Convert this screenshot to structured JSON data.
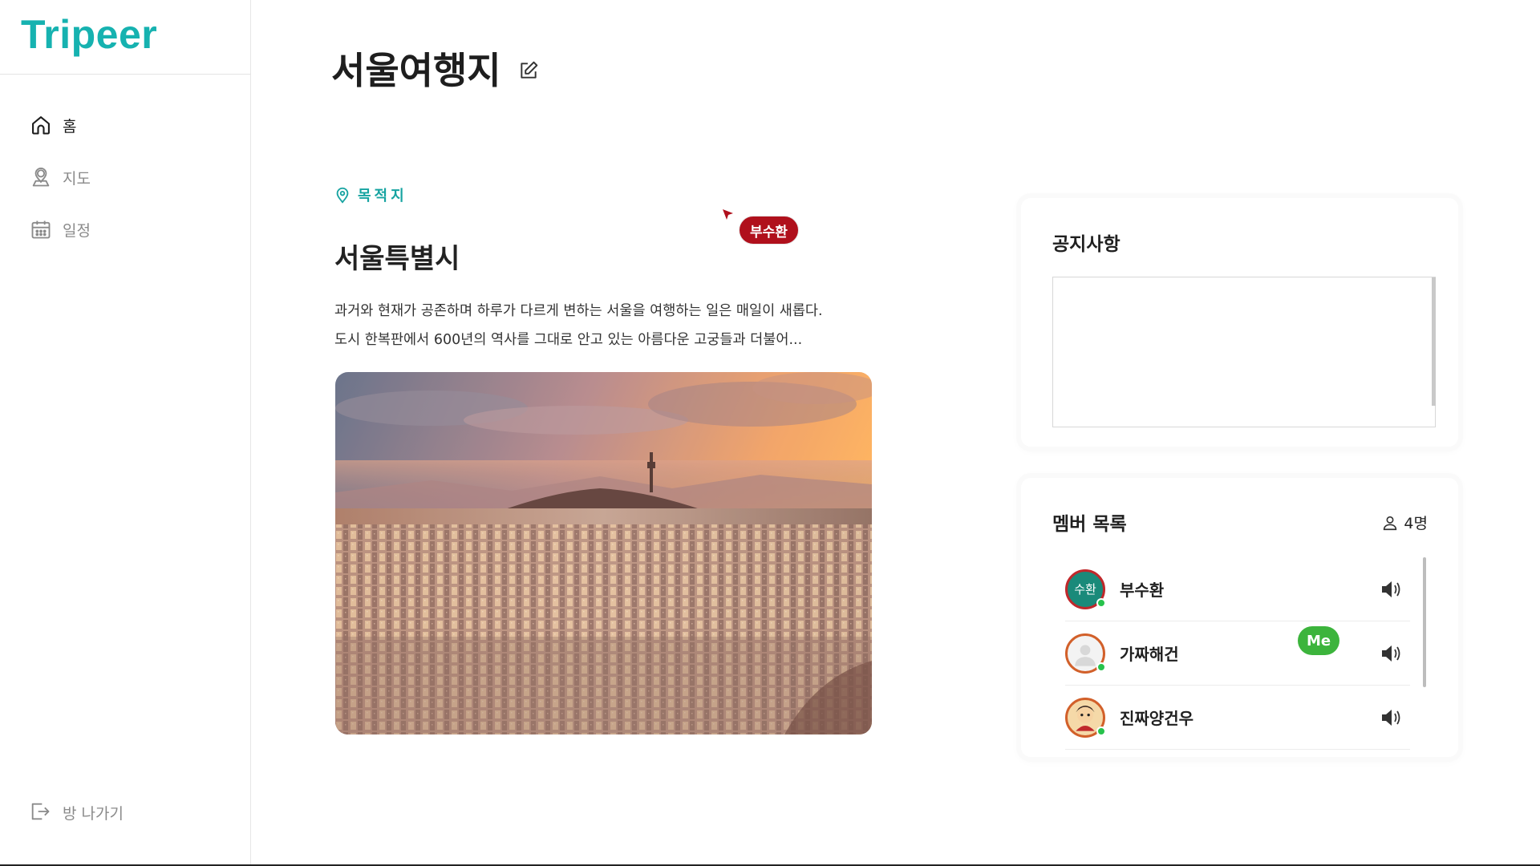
{
  "app": {
    "logo": "Tripeer",
    "brand_color": "#16b2b0"
  },
  "sidebar": {
    "items": [
      {
        "label": "홈",
        "icon": "home-icon",
        "active": true
      },
      {
        "label": "지도",
        "icon": "map-pin-person-icon",
        "active": false
      },
      {
        "label": "일정",
        "icon": "calendar-icon",
        "active": false
      }
    ],
    "leave_label": "방 나가기"
  },
  "header": {
    "title": "서울여행지"
  },
  "destination": {
    "tag": "목적지",
    "title": "서울특별시",
    "desc_line1": "과거와 현재가 공존하며 하루가 다르게 변하는 서울을 여행하는 일은 매일이 새롭다.",
    "desc_line2": "도시 한복판에서 600년의 역사를 그대로 안고 있는 아름다운 고궁들과 더불어..."
  },
  "cursor": {
    "user": "부수환",
    "color": "#b0101c"
  },
  "notice": {
    "title": "공지사항",
    "content": ""
  },
  "members": {
    "title": "멤버 목록",
    "count": "4명",
    "list": [
      {
        "name": "부수환",
        "avatar_text": "수환",
        "me": false,
        "online": true
      },
      {
        "name": "가짜해건",
        "avatar_text": "",
        "me": true,
        "me_label": "Me",
        "online": true
      },
      {
        "name": "진짜양건우",
        "avatar_text": "",
        "me": false,
        "online": true
      }
    ]
  }
}
